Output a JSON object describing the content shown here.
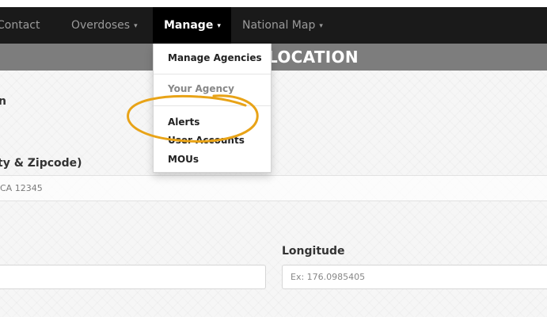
{
  "navbar": {
    "items": [
      {
        "label": "Contact",
        "has_caret": false
      },
      {
        "label": "Overdoses",
        "caret": "▾"
      },
      {
        "label": "Manage",
        "caret": "▾",
        "active": true
      },
      {
        "label": "National Map",
        "caret": "▾"
      }
    ]
  },
  "page": {
    "title": "LOCATION"
  },
  "form": {
    "name_label": "n",
    "address_label": "ty & Zipcode)",
    "address_value": "CA 12345",
    "longitude_label": "Longitude",
    "longitude_placeholder": "Ex: 176.0985405",
    "latitude_value": ""
  },
  "dropdown": {
    "items": [
      {
        "label": "Manage Agencies"
      },
      {
        "label": "Your Agency"
      },
      {
        "label": "Alerts"
      },
      {
        "label": "User Accounts"
      },
      {
        "label": "MOUs"
      }
    ]
  },
  "colors": {
    "navbar_bg": "#1a1a1a",
    "active_nav_bg": "#000000",
    "title_bar_bg": "#7d7d7d",
    "annotation_ring": "#e8a317"
  },
  "annotation": {
    "shape": "hand-drawn ellipse",
    "highlights": "Alerts"
  }
}
